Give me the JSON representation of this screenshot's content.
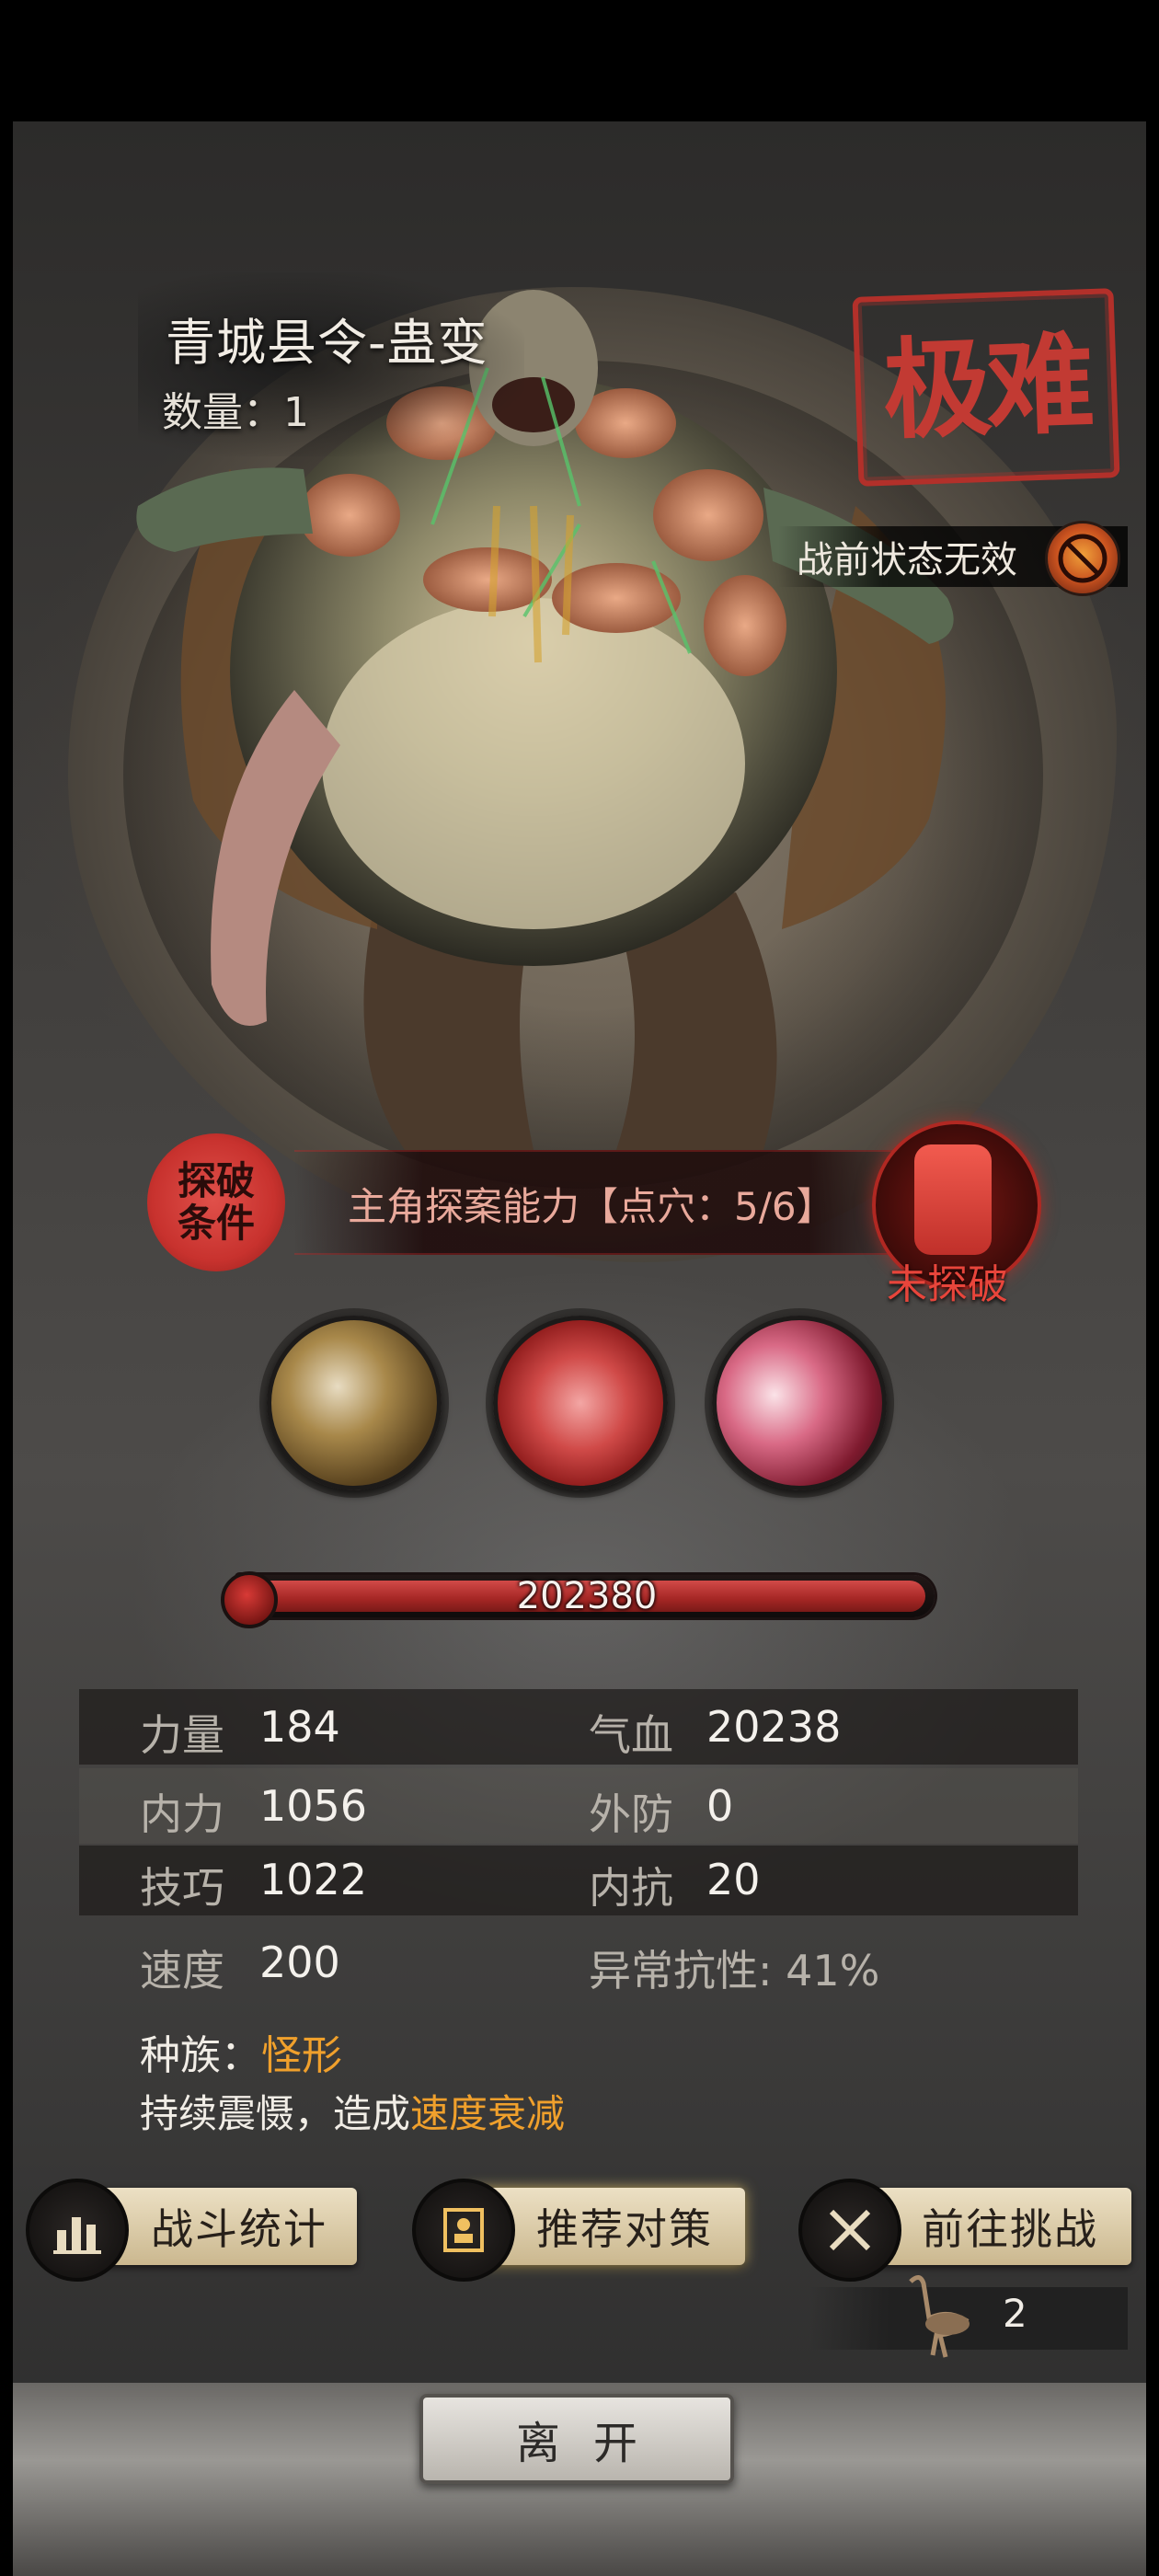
{
  "boss": {
    "name": "青城县令-蛊变",
    "count_label": "数量：1",
    "difficulty_stamp": "极难",
    "prebattle_status": "战前状态无效"
  },
  "discovery": {
    "badge_label": "探破条件",
    "requirement": "主角探案能力【点穴：5/6】",
    "status": "未探破"
  },
  "skills": [
    {
      "icon": "claw-strike-icon"
    },
    {
      "icon": "blade-slash-icon"
    },
    {
      "icon": "flesh-bite-icon"
    }
  ],
  "hp": {
    "value": "202380",
    "fill_fraction": 1.0
  },
  "stats": [
    {
      "left_label": "力量",
      "left_value": "184",
      "right_label": "气血",
      "right_value": "20238"
    },
    {
      "left_label": "内力",
      "left_value": "1056",
      "right_label": "外防",
      "right_value": "0"
    },
    {
      "left_label": "技巧",
      "left_value": "1022",
      "right_label": "内抗",
      "right_value": "20"
    },
    {
      "left_label": "速度",
      "left_value": "200",
      "right_label": "异常抗性: 41%",
      "right_value": ""
    }
  ],
  "race": {
    "label": "种族：",
    "value": "怪形"
  },
  "effect": {
    "prefix": "持续震慑，造成",
    "accent": "速度衰减"
  },
  "actions": {
    "battle_stats": "战斗统计",
    "recommend": "推荐对策",
    "challenge": "前往挑战"
  },
  "stamina": {
    "icon": "crane-icon",
    "count": "2"
  },
  "leave_label": "离开",
  "colors": {
    "accent_orange": "#f0a02c",
    "stamp_red": "#c23a33",
    "hp_red": "#a42624"
  }
}
